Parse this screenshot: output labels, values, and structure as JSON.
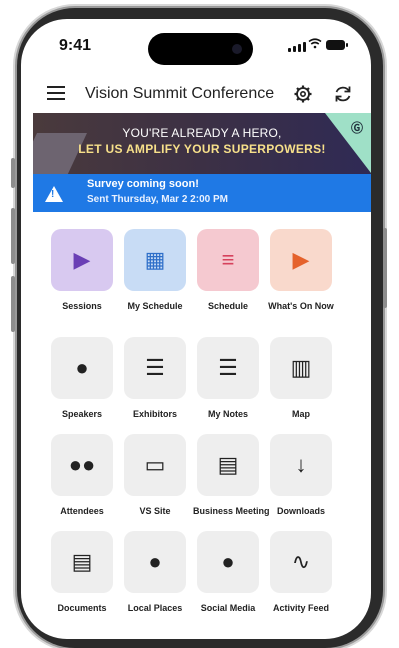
{
  "status_bar": {
    "time": "9:41"
  },
  "app_bar": {
    "title": "Vision Summit Conference"
  },
  "banner": {
    "line1": "YOU'RE ALREADY A HERO,",
    "line2": "LET US AMPLIFY YOUR SUPERPOWERS!"
  },
  "alert": {
    "title": "Survey coming soon!",
    "subtitle": "Sent Thursday, Mar 2 2:00 PM"
  },
  "tiles": [
    {
      "label": "Sessions",
      "icon": "presentation-icon",
      "bg": "#d8c9f0",
      "fg": "#6a3fb5"
    },
    {
      "label": "My Schedule",
      "icon": "calendar-icon",
      "bg": "#c8dcf5",
      "fg": "#2e6fc9"
    },
    {
      "label": "Schedule",
      "icon": "document-icon",
      "bg": "#f5c9d0",
      "fg": "#d6425d"
    },
    {
      "label": "What's On Now",
      "icon": "play-icon",
      "bg": "#f9d9cc",
      "fg": "#e5622c"
    },
    {
      "label": "Speakers",
      "icon": "speaker-person-icon",
      "bg": "#eeeeee",
      "fg": "#222222"
    },
    {
      "label": "Exhibitors",
      "icon": "exhibitor-icon",
      "bg": "#eeeeee",
      "fg": "#222222"
    },
    {
      "label": "My Notes",
      "icon": "notes-icon",
      "bg": "#eeeeee",
      "fg": "#222222"
    },
    {
      "label": "Map",
      "icon": "map-icon",
      "bg": "#eeeeee",
      "fg": "#222222"
    },
    {
      "label": "Attendees",
      "icon": "people-icon",
      "bg": "#eeeeee",
      "fg": "#222222"
    },
    {
      "label": "VS Site",
      "icon": "monitor-icon",
      "bg": "#eeeeee",
      "fg": "#222222"
    },
    {
      "label": "Business Meeting",
      "icon": "files-icon",
      "bg": "#eeeeee",
      "fg": "#222222"
    },
    {
      "label": "Downloads",
      "icon": "download-icon",
      "bg": "#eeeeee",
      "fg": "#222222"
    },
    {
      "label": "Documents",
      "icon": "file-icon",
      "bg": "#eeeeee",
      "fg": "#222222"
    },
    {
      "label": "Local Places",
      "icon": "pin-icon",
      "bg": "#eeeeee",
      "fg": "#222222"
    },
    {
      "label": "Social Media",
      "icon": "chat-bubble-icon",
      "bg": "#eeeeee",
      "fg": "#222222"
    },
    {
      "label": "Activity Feed",
      "icon": "activity-icon",
      "bg": "#eeeeee",
      "fg": "#222222"
    }
  ]
}
